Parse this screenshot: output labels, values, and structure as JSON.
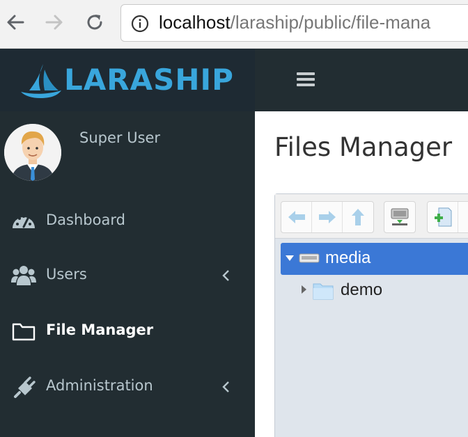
{
  "browser": {
    "url_host": "localhost",
    "url_path": "/laraship/public/file-mana"
  },
  "app": {
    "logo_text": "LARASHIP"
  },
  "sidebar": {
    "user_name": "Super User",
    "items": [
      {
        "label": "Dashboard",
        "icon": "dashboard-icon"
      },
      {
        "label": "Users",
        "icon": "users-icon"
      },
      {
        "label": "File Manager",
        "icon": "folder-icon"
      },
      {
        "label": "Administration",
        "icon": "plug-icon"
      }
    ]
  },
  "main": {
    "page_title": "Files Manager",
    "tree": [
      {
        "label": "media",
        "icon": "drive-icon",
        "selected": true
      },
      {
        "label": "demo",
        "icon": "folder-icon",
        "selected": false
      }
    ]
  },
  "colors": {
    "sidebar_bg": "#222d32",
    "logo_blue": "#39a6dc",
    "selection_blue": "#3b78d6"
  }
}
